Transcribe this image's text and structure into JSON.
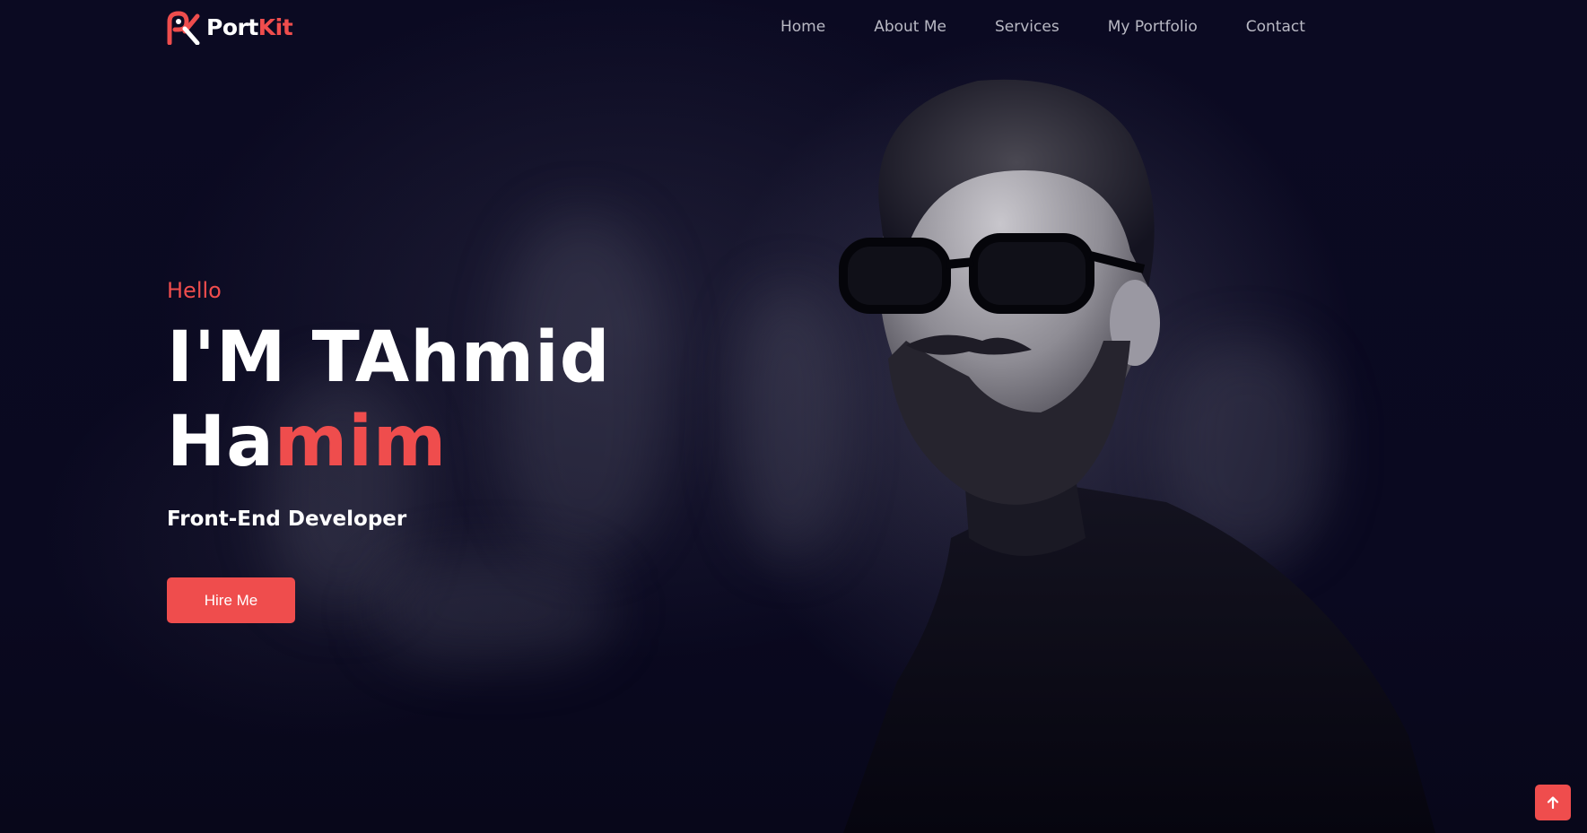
{
  "brand": {
    "name_part1": "Port",
    "name_part2": "Kit",
    "logo_icon": "pk-logo-icon"
  },
  "nav": {
    "items": [
      {
        "label": "Home"
      },
      {
        "label": "About Me"
      },
      {
        "label": "Services"
      },
      {
        "label": "My Portfolio"
      },
      {
        "label": "Contact"
      }
    ]
  },
  "hero": {
    "greeting": "Hello",
    "name_line1": "I'M TAhmid",
    "name_line2_part1": "Ha",
    "name_line2_part2": "mim",
    "role": "Front-End Developer",
    "cta_label": "Hire Me",
    "portrait": "portrait-photo"
  },
  "scroll_top": {
    "icon": "arrow-up-icon"
  },
  "colors": {
    "accent": "#ef4d4d",
    "background": "#0a0920",
    "text": "#ffffff",
    "nav_text": "#b9b9c4"
  }
}
